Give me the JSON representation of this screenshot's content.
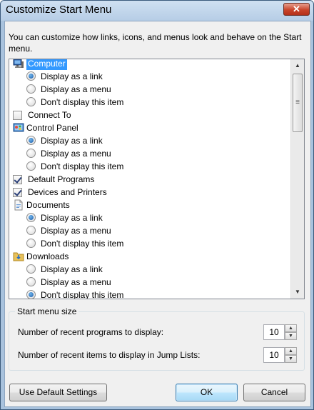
{
  "window": {
    "title": "Customize Start Menu",
    "close_glyph": "✕"
  },
  "description": "You can customize how links, icons, and menus look and behave on the Start menu.",
  "options": [
    {
      "type": "item",
      "label": "Computer",
      "icon": "computer-icon",
      "selected": true
    },
    {
      "type": "radio",
      "label": "Display as a link",
      "checked": true
    },
    {
      "type": "radio",
      "label": "Display as a menu",
      "checked": false
    },
    {
      "type": "radio",
      "label": "Don't display this item",
      "checked": false
    },
    {
      "type": "checkbox",
      "label": "Connect To",
      "checked": false
    },
    {
      "type": "item",
      "label": "Control Panel",
      "icon": "control-panel-icon"
    },
    {
      "type": "radio",
      "label": "Display as a link",
      "checked": true
    },
    {
      "type": "radio",
      "label": "Display as a menu",
      "checked": false
    },
    {
      "type": "radio",
      "label": "Don't display this item",
      "checked": false
    },
    {
      "type": "checkbox",
      "label": "Default Programs",
      "checked": true
    },
    {
      "type": "checkbox",
      "label": "Devices and Printers",
      "checked": true
    },
    {
      "type": "item",
      "label": "Documents",
      "icon": "documents-icon"
    },
    {
      "type": "radio",
      "label": "Display as a link",
      "checked": true
    },
    {
      "type": "radio",
      "label": "Display as a menu",
      "checked": false
    },
    {
      "type": "radio",
      "label": "Don't display this item",
      "checked": false
    },
    {
      "type": "item",
      "label": "Downloads",
      "icon": "downloads-folder-icon"
    },
    {
      "type": "radio",
      "label": "Display as a link",
      "checked": false
    },
    {
      "type": "radio",
      "label": "Display as a menu",
      "checked": false
    },
    {
      "type": "radio",
      "label": "Don't display this item",
      "checked": true
    }
  ],
  "start_menu_size": {
    "title": "Start menu size",
    "recent_programs": {
      "label": "Number of recent programs to display:",
      "value": "10"
    },
    "recent_items": {
      "label": "Number of recent items to display in Jump Lists:",
      "value": "10"
    }
  },
  "buttons": {
    "use_default": "Use Default Settings",
    "ok": "OK",
    "cancel": "Cancel"
  },
  "scrollbar": {
    "up": "▲",
    "down": "▼",
    "grip": "≡"
  },
  "spinner": {
    "up": "▲",
    "down": "▼"
  }
}
